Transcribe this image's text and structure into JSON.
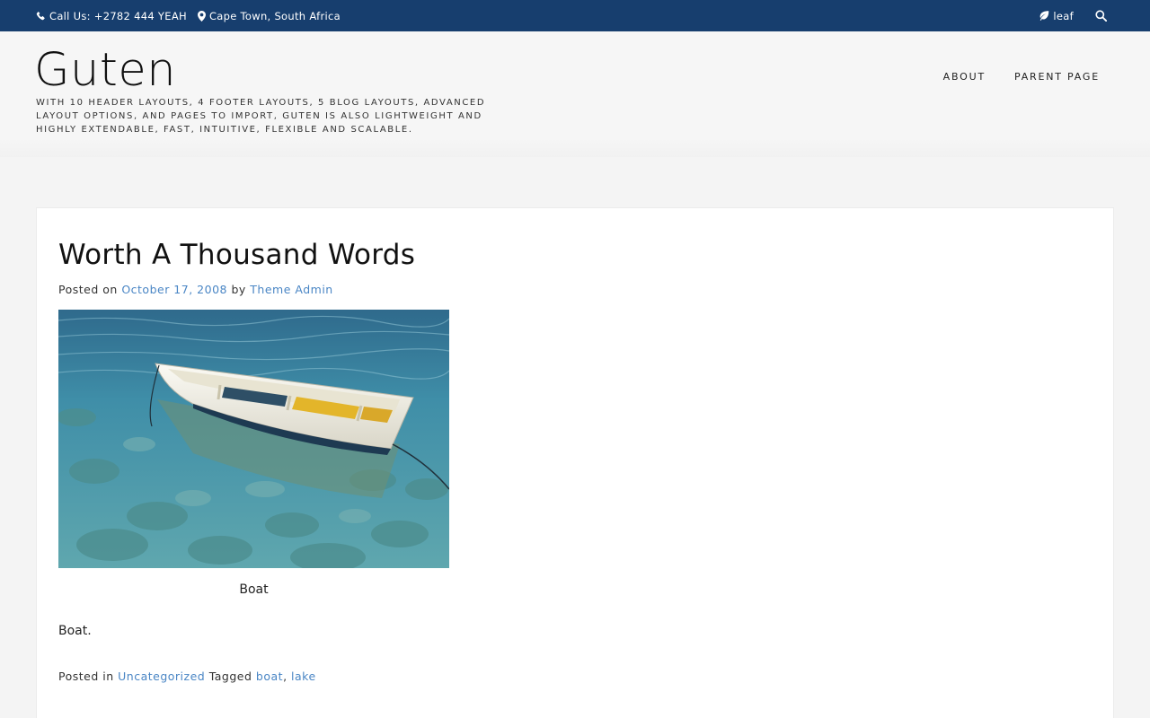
{
  "topbar": {
    "phone": "Call Us: +2782 444 YEAH",
    "location": "Cape Town, South Africa",
    "leaf_label": "leaf"
  },
  "header": {
    "site_title": "Guten",
    "tagline": "With 10 header layouts, 4 footer layouts, 5 blog layouts, advanced layout options, and pages to import, Guten is also lightweight and highly extendable, fast, intuitive, flexible and scalable.",
    "nav": [
      "About",
      "Parent Page"
    ]
  },
  "post": {
    "title": "Worth A Thousand Words",
    "posted_on_label": "Posted on",
    "date": "October 17, 2008",
    "by_label": "by",
    "author": "Theme Admin",
    "caption": "Boat",
    "body": "Boat.",
    "posted_in_label": "Posted in",
    "category": "Uncategorized",
    "tagged_label": "Tagged",
    "tags": [
      "boat",
      "lake"
    ],
    "tag_separator": ","
  },
  "colors": {
    "topbar_bg": "#173e6e",
    "link": "#4a86c5"
  }
}
